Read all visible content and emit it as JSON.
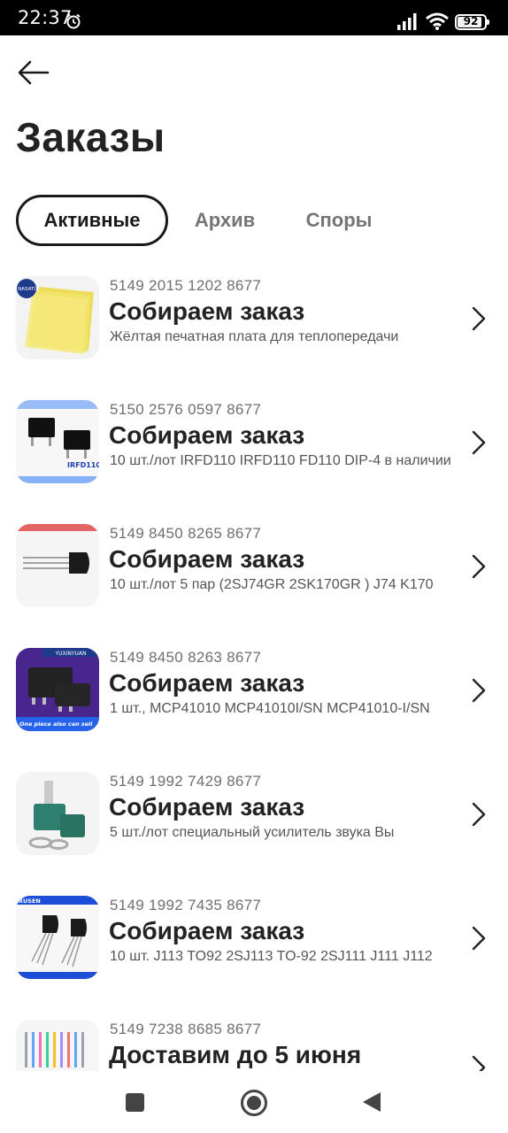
{
  "status_bar": {
    "time": "22:37",
    "battery": "92",
    "battery_level": 0.92,
    "icons": [
      "alarm-icon",
      "signal-icon",
      "wifi-icon",
      "battery-icon"
    ]
  },
  "header": {
    "back_icon": "arrow-left-icon",
    "title": "Заказы"
  },
  "tabs": [
    {
      "label": "Активные",
      "active": true
    },
    {
      "label": "Архив",
      "active": false
    },
    {
      "label": "Споры",
      "active": false
    }
  ],
  "orders": [
    {
      "number": "5149 2015 1202 8677",
      "status": "Собираем заказ",
      "description": "Жёлтая печатная плата для теплопередачи"
    },
    {
      "number": "5150 2576 0597 8677",
      "status": "Собираем заказ",
      "description": "10 шт./лот IRFD110 IRFD110 FD110 DIP-4 в наличии"
    },
    {
      "number": "5149 8450 8265 8677",
      "status": "Собираем заказ",
      "description": "10 шт./лот 5 пар (2SJ74GR 2SK170GR ) J74 K170"
    },
    {
      "number": "5149 8450 8263 8677",
      "status": "Собираем заказ",
      "description": "1 шт., MCP41010 MCP41010I/SN MCP41010-I/SN"
    },
    {
      "number": "5149 1992 7429 8677",
      "status": "Собираем заказ",
      "description": "5 шт./лот специальный усилитель звука Вы"
    },
    {
      "number": "5149 1992 7435 8677",
      "status": "Собираем заказ",
      "description": "10 шт. J113 TO92 2SJ113 TO-92 2SJ111 J111 J112"
    },
    {
      "number": "5149 7238 8685 8677",
      "status": "Доставим до 5 июня",
      "description": ""
    }
  ],
  "thumb_labels": {
    "nasati": "NASATI",
    "yuxinyuan": "YUXINYUAN",
    "one_piece": "One piece also can sell",
    "irfd": "IRFD110",
    "xusen": "XUSEN"
  },
  "nav_bar": {
    "icons": [
      "recent-apps-icon",
      "home-icon",
      "back-triangle-icon"
    ]
  }
}
